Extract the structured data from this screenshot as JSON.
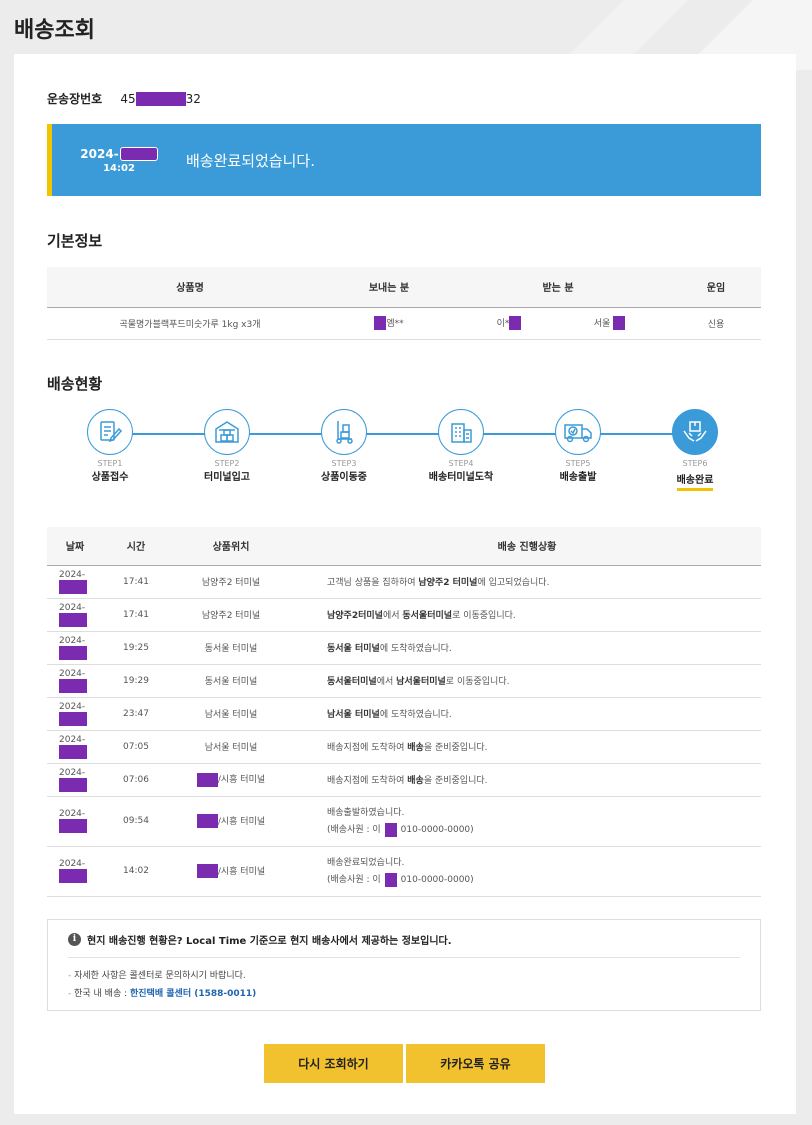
{
  "page": {
    "title": "배송조회"
  },
  "waybill": {
    "label": "운송장번호",
    "prefix": "45",
    "suffix": "32"
  },
  "status": {
    "date_prefix": "2024-",
    "time": "14:02",
    "message": "배송완료되었습니다."
  },
  "basic_info": {
    "title": "기본정보",
    "headers": [
      "상품명",
      "보내는 분",
      "받는 분",
      "운임"
    ],
    "product": "곡물명가블랙푸드미숫가루 1kg x3개",
    "sender": "엠**",
    "receiver_name": "이*",
    "receiver_addr": "서울",
    "fee": "신용"
  },
  "progress": {
    "title": "배송현황",
    "steps": [
      {
        "num": "STEP1",
        "label": "상품접수",
        "icon": "receipt-pen-icon"
      },
      {
        "num": "STEP2",
        "label": "터미널입고",
        "icon": "warehouse-icon"
      },
      {
        "num": "STEP3",
        "label": "상품이동중",
        "icon": "hand-truck-icon"
      },
      {
        "num": "STEP4",
        "label": "배송터미널도착",
        "icon": "building-icon"
      },
      {
        "num": "STEP5",
        "label": "배송출발",
        "icon": "delivery-truck-icon"
      },
      {
        "num": "STEP6",
        "label": "배송완료",
        "icon": "hands-box-icon"
      }
    ],
    "active_step": 6
  },
  "tracking": {
    "headers": [
      "날짜",
      "시간",
      "상품위치",
      "배송 진행상황"
    ],
    "date_prefix": "2024-",
    "rows": [
      {
        "time": "17:41",
        "loc": "남양주2 터미널",
        "s1": "고객님 상품을 집하하여 ",
        "b1": "남양주2 터미널",
        "s2": "에 입고되었습니다."
      },
      {
        "time": "17:41",
        "loc": "남양주2 터미널",
        "s1": "",
        "b1": "남양주2터미널",
        "s2": "에서 ",
        "b2": "동서울터미널",
        "s3": "로 이동중입니다."
      },
      {
        "time": "19:25",
        "loc": "동서울 터미널",
        "s1": "",
        "b1": "동서울 터미널",
        "s2": "에 도착하였습니다."
      },
      {
        "time": "19:29",
        "loc": "동서울 터미널",
        "s1": "",
        "b1": "동서울터미널",
        "s2": "에서 ",
        "b2": "남서울터미널",
        "s3": "로 이동중입니다."
      },
      {
        "time": "23:47",
        "loc": "남서울 터미널",
        "s1": "",
        "b1": "남서울 터미널",
        "s2": "에 도착하였습니다."
      },
      {
        "time": "07:05",
        "loc": "남서울 터미널",
        "s1": "배송지점에 도착하여 ",
        "b1": "배송",
        "s2": "을 준비중입니다."
      },
      {
        "time": "07:06",
        "loc": "/시흥 터미널",
        "s1": "배송지점에 도착하여 ",
        "b1": "배송",
        "s2": "을 준비중입니다."
      },
      {
        "time": "09:54",
        "loc": "/시흥 터미널",
        "line1": "배송출발하였습니다.",
        "line2a": "(배송사원 : 이",
        "line2b": "010-0000-0000)"
      },
      {
        "time": "14:02",
        "loc": "/시흥 터미널",
        "line1": "배송완료되었습니다.",
        "line2a": "(배송사원 : 이",
        "line2b": "010-0000-0000)"
      }
    ]
  },
  "notice": {
    "icon": "info-icon",
    "icon_glyph": "i",
    "headline": "현지 배송진행 현황은? Local Time 기준으로 현지 배송사에서 제공하는 정보입니다.",
    "item1": "자세한 사항은 콜센터로 문의하시기 바랍니다.",
    "item2_prefix": "한국 내 배송 : ",
    "item2_link": "한진택배 콜센터 (1588-0011)"
  },
  "buttons": {
    "retry": "다시 조회하기",
    "share": "카카오톡 공유"
  },
  "colors": {
    "accent": "#3a9bd8",
    "highlight": "#f2c300",
    "button": "#f2c12e",
    "mask": "#7a2bb0"
  }
}
